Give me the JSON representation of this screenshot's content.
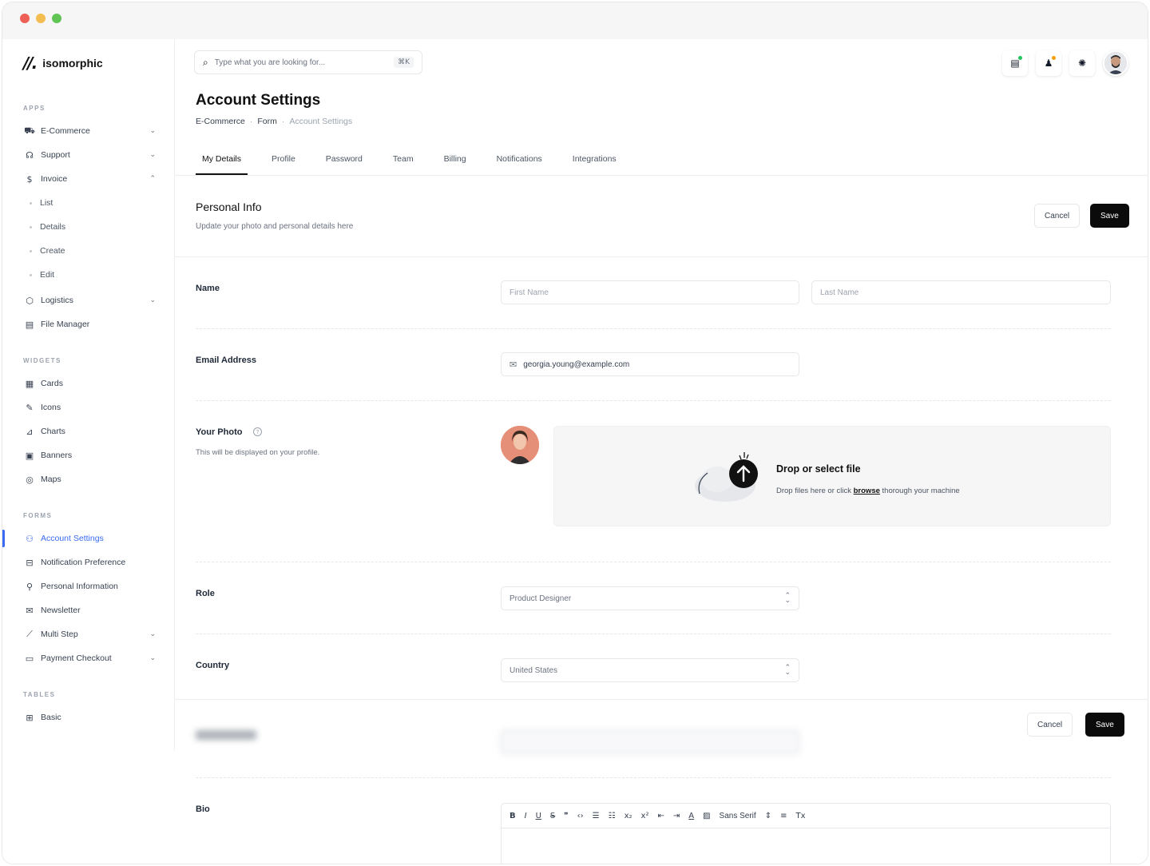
{
  "brand": {
    "name": "isomorphic"
  },
  "sidebar": {
    "sections": {
      "apps": "APPS",
      "widgets": "WIDGETS",
      "forms": "FORMS",
      "tables": "TABLES"
    },
    "apps": [
      {
        "label": "E-Commerce",
        "icon": "cart-icon",
        "chevron": "down"
      },
      {
        "label": "Support",
        "icon": "headset-icon",
        "chevron": "down"
      },
      {
        "label": "Invoice",
        "icon": "dollar-icon",
        "chevron": "up"
      }
    ],
    "invoice_sub": [
      "List",
      "Details",
      "Create",
      "Edit"
    ],
    "apps_more": [
      {
        "label": "Logistics",
        "icon": "package-icon",
        "chevron": "down"
      },
      {
        "label": "File Manager",
        "icon": "file-icon",
        "chevron": ""
      }
    ],
    "widgets": [
      {
        "label": "Cards",
        "icon": "grid-icon"
      },
      {
        "label": "Icons",
        "icon": "feather-icon"
      },
      {
        "label": "Charts",
        "icon": "chart-icon"
      },
      {
        "label": "Banners",
        "icon": "image-icon"
      },
      {
        "label": "Maps",
        "icon": "globe-icon"
      }
    ],
    "forms": [
      {
        "label": "Account Settings",
        "icon": "user-gear-icon",
        "chevron": "",
        "active": true
      },
      {
        "label": "Notification Preference",
        "icon": "bell-icon",
        "chevron": ""
      },
      {
        "label": "Personal Information",
        "icon": "user-icon",
        "chevron": ""
      },
      {
        "label": "Newsletter",
        "icon": "envelope-icon",
        "chevron": ""
      },
      {
        "label": "Multi Step",
        "icon": "steps-icon",
        "chevron": "down"
      },
      {
        "label": "Payment Checkout",
        "icon": "card-icon",
        "chevron": "down"
      }
    ],
    "tables": [
      {
        "label": "Basic",
        "icon": "table-icon"
      }
    ]
  },
  "header": {
    "search_placeholder": "Type what you are looking for...",
    "search_shortcut": "⌘K",
    "badge_colors": {
      "messages": "#22c55e",
      "notifications": "#f59e0b"
    }
  },
  "page": {
    "title": "Account Settings",
    "breadcrumb": [
      "E-Commerce",
      "Form",
      "Account Settings"
    ]
  },
  "tabs": [
    "My Details",
    "Profile",
    "Password",
    "Team",
    "Billing",
    "Notifications",
    "Integrations"
  ],
  "personal_info": {
    "title": "Personal Info",
    "subtitle": "Update your photo and personal details here",
    "cancel": "Cancel",
    "save": "Save"
  },
  "form": {
    "name_label": "Name",
    "first_name_placeholder": "First Name",
    "last_name_placeholder": "Last Name",
    "email_label": "Email Address",
    "email_value": "georgia.young@example.com",
    "photo_label": "Your Photo",
    "photo_sub": "This will be displayed on your profile.",
    "dropzone_title": "Drop or select file",
    "dropzone_sub_before": "Drop files here or click ",
    "dropzone_link": "browse",
    "dropzone_sub_after": " thorough your machine",
    "role_label": "Role",
    "role_value": "Product Designer",
    "country_label": "Country",
    "country_value": "United States",
    "bio_label": "Bio",
    "bio_font": "Sans Serif"
  },
  "sticky": {
    "cancel": "Cancel",
    "save": "Save"
  }
}
